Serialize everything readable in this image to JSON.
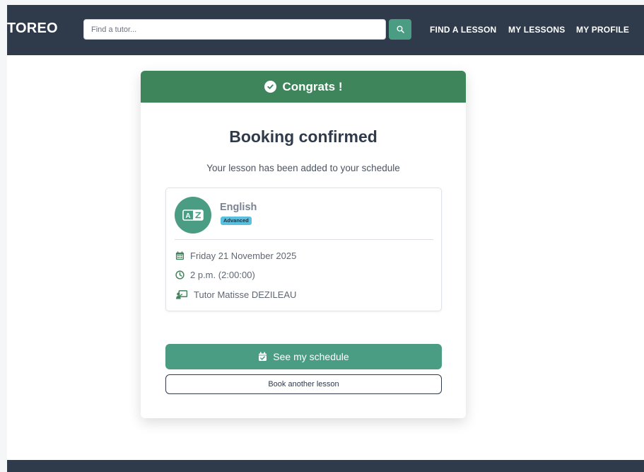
{
  "navbar": {
    "brand": "TOREO",
    "search": {
      "placeholder": "Find a tutor..."
    },
    "links": [
      "FIND A LESSON",
      "MY LESSONS",
      "MY PROFILE"
    ]
  },
  "card": {
    "header": "Congrats !",
    "title": "Booking confirmed",
    "subtitle": "Your lesson has been added to your schedule",
    "lesson": {
      "subject": "English",
      "level": "Advanced",
      "date": "Friday 21 November 2025",
      "time": "2 p.m. (2:00:00)",
      "tutor": "Tutor Matisse DEZILEAU"
    },
    "primary_button": "See my schedule",
    "secondary_button": "Book another lesson"
  },
  "colors": {
    "navbar": "#2f3a4b",
    "accent": "#4a9d83",
    "header_green": "#3f855c",
    "badge": "#5bc0de"
  },
  "icons": [
    "search-icon",
    "check-circle-icon",
    "translate-icon",
    "calendar-icon",
    "clock-icon",
    "teacher-icon",
    "calendar-check-icon"
  ]
}
